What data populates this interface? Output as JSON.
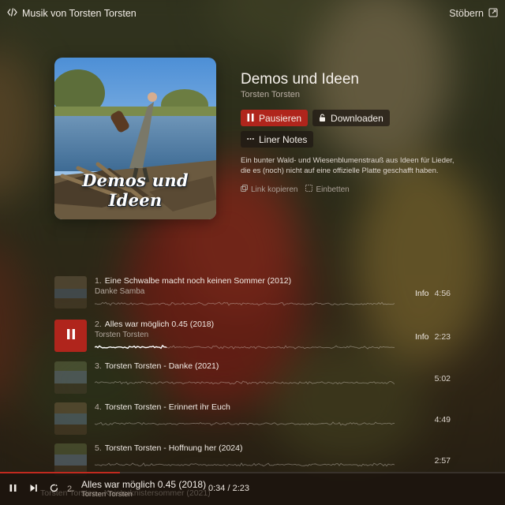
{
  "header": {
    "brand": "Musik von Torsten Torsten",
    "browse_label": "Stöbern"
  },
  "release": {
    "cover_text": "Demos und Ideen",
    "title": "Demos und Ideen",
    "artist": "Torsten Torsten",
    "pause_label": "Pausieren",
    "download_label": "Downloaden",
    "liner_notes_label": "Liner Notes",
    "description": "Ein bunter Wald- und Wiesenblumenstrauß aus Ideen für Lieder, die es (noch) nicht auf eine offizielle Platte geschafft haben.",
    "copy_link_label": "Link kopieren",
    "embed_label": "Einbetten"
  },
  "tracks": [
    {
      "number": "1.",
      "title": "Eine Schwalbe macht noch keinen Sommer (2012)",
      "artist": "Danke Samba",
      "info": "Info",
      "duration": "4:56",
      "active": false
    },
    {
      "number": "2.",
      "title": "Alles war möglich 0.45 (2018)",
      "artist": "Torsten Torsten",
      "info": "Info",
      "duration": "2:23",
      "active": true,
      "played_fraction": 0.24
    },
    {
      "number": "3.",
      "title": "Torsten Torsten - Danke (2021)",
      "artist": "",
      "info": "",
      "duration": "5:02",
      "active": false
    },
    {
      "number": "4.",
      "title": "Torsten Torsten - Erinnert ihr Euch",
      "artist": "",
      "info": "",
      "duration": "4:49",
      "active": false
    },
    {
      "number": "5.",
      "title": "Torsten Torsten - Hoffnung her (2024)",
      "artist": "",
      "info": "",
      "duration": "2:57",
      "active": false
    }
  ],
  "player": {
    "track_number": "2.",
    "title": "Alles war möglich 0.45 (2018)",
    "artist": "Torsten Torsten",
    "time": "0:34 / 2:23",
    "progress_fraction": 0.238,
    "next_track_partial": "Torsten Torsten - Knisterknistersommer (2021)"
  },
  "colors": {
    "accent": "#b0251c",
    "progress": "#c22a1f"
  },
  "icons": {
    "brand": "code-icon",
    "browse": "external-link-icon",
    "pause": "pause-icon",
    "download": "lock-icon",
    "liner_notes": "ellipsis-icon",
    "copy_link": "copy-icon",
    "embed": "embed-icon",
    "next": "skip-next-icon",
    "loop": "repeat-icon"
  }
}
